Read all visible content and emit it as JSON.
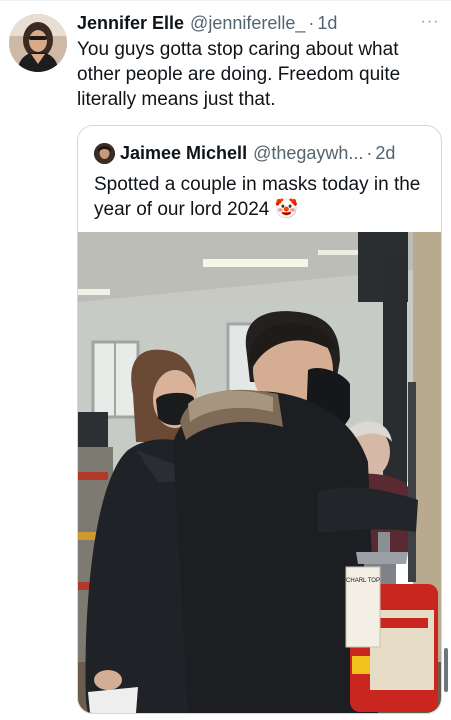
{
  "tweet": {
    "author_name": "Jennifer Elle",
    "author_handle": "@jenniferelle_",
    "separator": "·",
    "time": "1d",
    "more_label": "···",
    "text": "You guys gotta stop caring about what other people are doing. Freedom quite literally means just that."
  },
  "quote": {
    "author_name": "Jaimee Michell",
    "author_handle": "@thegaywh...",
    "separator": "·",
    "time": "2d",
    "text": "Spotted a couple in masks today in the year of our lord 2024 🤡"
  },
  "photo": {
    "extinguisher_tag_text": "CHARL TOP"
  }
}
